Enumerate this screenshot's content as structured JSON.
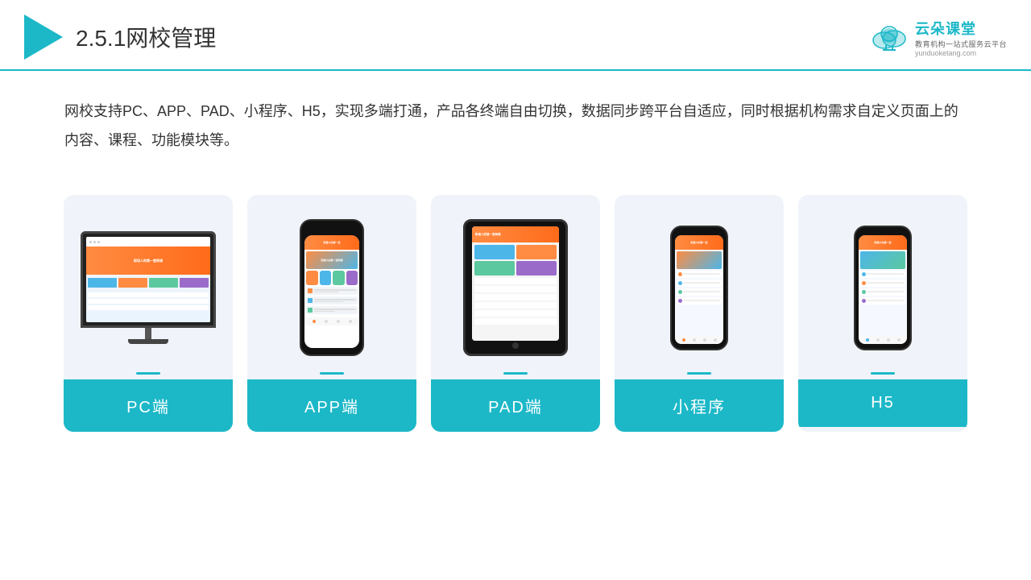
{
  "header": {
    "title_prefix": "2.5.1",
    "title_main": "网校管理",
    "brand_name": "云朵课堂",
    "brand_tagline": "教育机构一站\n式服务云平台",
    "brand_url": "yunduoketang.com"
  },
  "description": {
    "text": "网校支持PC、APP、PAD、小程序、H5，实现多端打通，产品各终端自由切换，数据同步跨平台自适应，同时根据机构需求自定义页面上的内容、课程、功能模块等。"
  },
  "cards": [
    {
      "id": "pc",
      "label": "PC端"
    },
    {
      "id": "app",
      "label": "APP端"
    },
    {
      "id": "pad",
      "label": "PAD端"
    },
    {
      "id": "miniprogram",
      "label": "小程序"
    },
    {
      "id": "h5",
      "label": "H5"
    }
  ],
  "colors": {
    "accent": "#1cb8c8",
    "orange": "#ff8c42",
    "blue": "#4db6e8",
    "green": "#5bc8a0",
    "purple": "#9b6bca"
  }
}
